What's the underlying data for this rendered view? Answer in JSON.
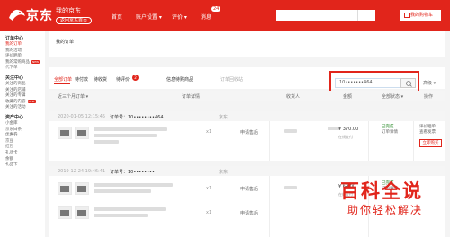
{
  "header": {
    "brand": "京东",
    "subtitle": "我的京东",
    "home_link": "返回京东首页",
    "nav": [
      "首页",
      "账户设置 ▾",
      "评价 ▾",
      "消息"
    ],
    "message_count": "24",
    "cart_label": "我的购物车"
  },
  "sidebar": {
    "groups": [
      {
        "title": "订单中心",
        "items": [
          {
            "label": "我的订单",
            "active": true
          },
          {
            "label": "我的活动"
          },
          {
            "label": "评价晒单"
          },
          {
            "label": "我的常购商品",
            "hot": "NEW"
          },
          {
            "label": "代下单"
          }
        ]
      },
      {
        "title": "关注中心",
        "items": [
          {
            "label": "关注的商品"
          },
          {
            "label": "关注的店铺"
          },
          {
            "label": "关注的专辑"
          },
          {
            "label": "收藏的内容",
            "hot": "NEW"
          },
          {
            "label": "关注的活动"
          }
        ]
      },
      {
        "title": "资产中心",
        "items": [
          {
            "label": "小金库"
          },
          {
            "label": "京东白条"
          },
          {
            "label": "优惠券"
          },
          {
            "label": "京豆"
          },
          {
            "label": "红包"
          },
          {
            "label": "礼品卡"
          },
          {
            "label": "余额"
          },
          {
            "label": "礼品卡"
          }
        ]
      }
    ]
  },
  "main": {
    "title": "我的订单",
    "tabs": [
      "全部订单",
      "待付款",
      "待收货",
      "待评价"
    ],
    "tab_badge": "2",
    "links": [
      "信息待购商品",
      "订单回收站"
    ],
    "search_value": "10•••••••464",
    "more_label": "高级 ▾",
    "columns": [
      "近三个月订单 ▾",
      "订单详情",
      "收货人",
      "金额",
      "全部状态 ▾",
      "操作"
    ]
  },
  "orders": [
    {
      "date": "2020-01-05 12:15:45",
      "order_no": "订单号：10••••••••464",
      "shop": "京东",
      "qty": "x1",
      "aftersale": "申请售后",
      "price": "¥ 370.00",
      "pay": "在线支付",
      "status": "已完成",
      "status_links": [
        "订单详情"
      ],
      "ops": [
        "评价晒单",
        "查看发票"
      ],
      "rebuy": "立即购买"
    },
    {
      "date": "2019-12-24 19:46:41",
      "order_no": "订单号：10••••••••",
      "shop": "京东",
      "qty": "x1",
      "aftersale": "申请售后",
      "price": "¥ 69.00",
      "pay": "在线支付",
      "status": "已完成",
      "status_links": [
        "订单详情"
      ],
      "ops": [
        "评价晒单"
      ],
      "rebuy": "立即购买"
    }
  ],
  "watermark": {
    "big": "百科全说",
    "small": "助你轻松解决"
  }
}
